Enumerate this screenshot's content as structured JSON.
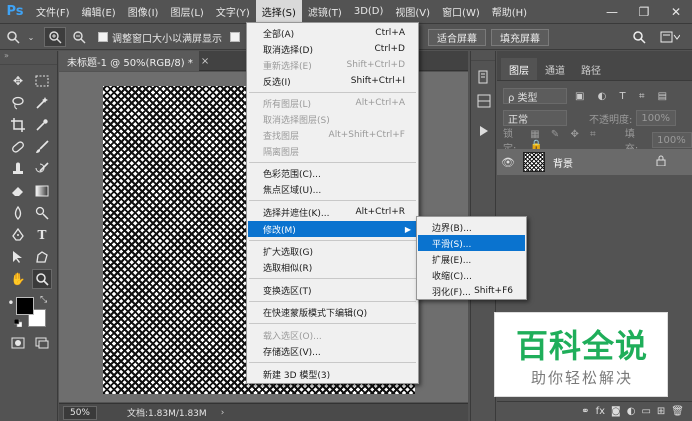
{
  "app": {
    "logo": "Ps"
  },
  "menubar": {
    "items": [
      "文件(F)",
      "编辑(E)",
      "图像(I)",
      "图层(L)",
      "文字(Y)",
      "选择(S)",
      "滤镜(T)",
      "3D(D)",
      "视图(V)",
      "窗口(W)",
      "帮助(H)"
    ],
    "active_index": 5
  },
  "window_controls": {
    "minimize": "—",
    "restore": "❐",
    "close": "✕"
  },
  "options": {
    "resize_windows_label": "调整窗口大小以满屏显示",
    "fit_screen_label": "适合屏幕",
    "fill_screen_label": "填充屏幕"
  },
  "document": {
    "tab_title": "未标题-1 @ 50%(RGB/8) *",
    "tab_close": "×",
    "zoom": "50%",
    "doc_info": "文档:1.83M/1.83M",
    "status_arrow": "›"
  },
  "layers_panel": {
    "tabs": [
      "图层",
      "通道",
      "路径"
    ],
    "active_tab": 0,
    "filter_kind": "ρ 类型",
    "blend_mode": "正常",
    "opacity_label": "不透明度:",
    "opacity_value": "100%",
    "lock_label": "锁定:",
    "fill_label": "填充:",
    "fill_value": "100%",
    "layer_name": "背景"
  },
  "select_menu": {
    "items": [
      {
        "label": "全部(A)",
        "shortcut": "Ctrl+A",
        "disabled": false
      },
      {
        "label": "取消选择(D)",
        "shortcut": "Ctrl+D",
        "disabled": false
      },
      {
        "label": "重新选择(E)",
        "shortcut": "Shift+Ctrl+D",
        "disabled": true
      },
      {
        "label": "反选(I)",
        "shortcut": "Shift+Ctrl+I",
        "disabled": false
      },
      {
        "label": "所有图层(L)",
        "shortcut": "Alt+Ctrl+A",
        "disabled": true
      },
      {
        "label": "取消选择图层(S)",
        "shortcut": "",
        "disabled": true
      },
      {
        "label": "查找图层",
        "shortcut": "Alt+Shift+Ctrl+F",
        "disabled": true
      },
      {
        "label": "隔离图层",
        "shortcut": "",
        "disabled": true
      },
      {
        "label": "色彩范围(C)...",
        "shortcut": "",
        "disabled": false
      },
      {
        "label": "焦点区域(U)...",
        "shortcut": "",
        "disabled": false
      },
      {
        "label": "选择并遮住(K)...",
        "shortcut": "Alt+Ctrl+R",
        "disabled": false
      },
      {
        "label": "修改(M)",
        "shortcut": "",
        "disabled": false
      },
      {
        "label": "扩大选取(G)",
        "shortcut": "",
        "disabled": false
      },
      {
        "label": "选取相似(R)",
        "shortcut": "",
        "disabled": false
      },
      {
        "label": "变换选区(T)",
        "shortcut": "",
        "disabled": false
      },
      {
        "label": "在快速蒙版模式下编辑(Q)",
        "shortcut": "",
        "disabled": false
      },
      {
        "label": "载入选区(O)...",
        "shortcut": "",
        "disabled": true
      },
      {
        "label": "存储选区(V)...",
        "shortcut": "",
        "disabled": false
      },
      {
        "label": "新建 3D 模型(3)",
        "shortcut": "",
        "disabled": false
      }
    ],
    "submenu_arrow": "▶"
  },
  "modify_submenu": {
    "items": [
      {
        "label": "边界(B)...",
        "shortcut": ""
      },
      {
        "label": "平滑(S)...",
        "shortcut": ""
      },
      {
        "label": "扩展(E)...",
        "shortcut": ""
      },
      {
        "label": "收缩(C)...",
        "shortcut": ""
      },
      {
        "label": "羽化(F)...",
        "shortcut": "Shift+F6"
      }
    ]
  },
  "watermark": {
    "title": "百科全说",
    "subtitle": "助你轻松解决"
  },
  "colors": {
    "accent": "#0a73cf",
    "ps_blue": "#3fa3f5",
    "watermark_green": "#1fae5a"
  }
}
